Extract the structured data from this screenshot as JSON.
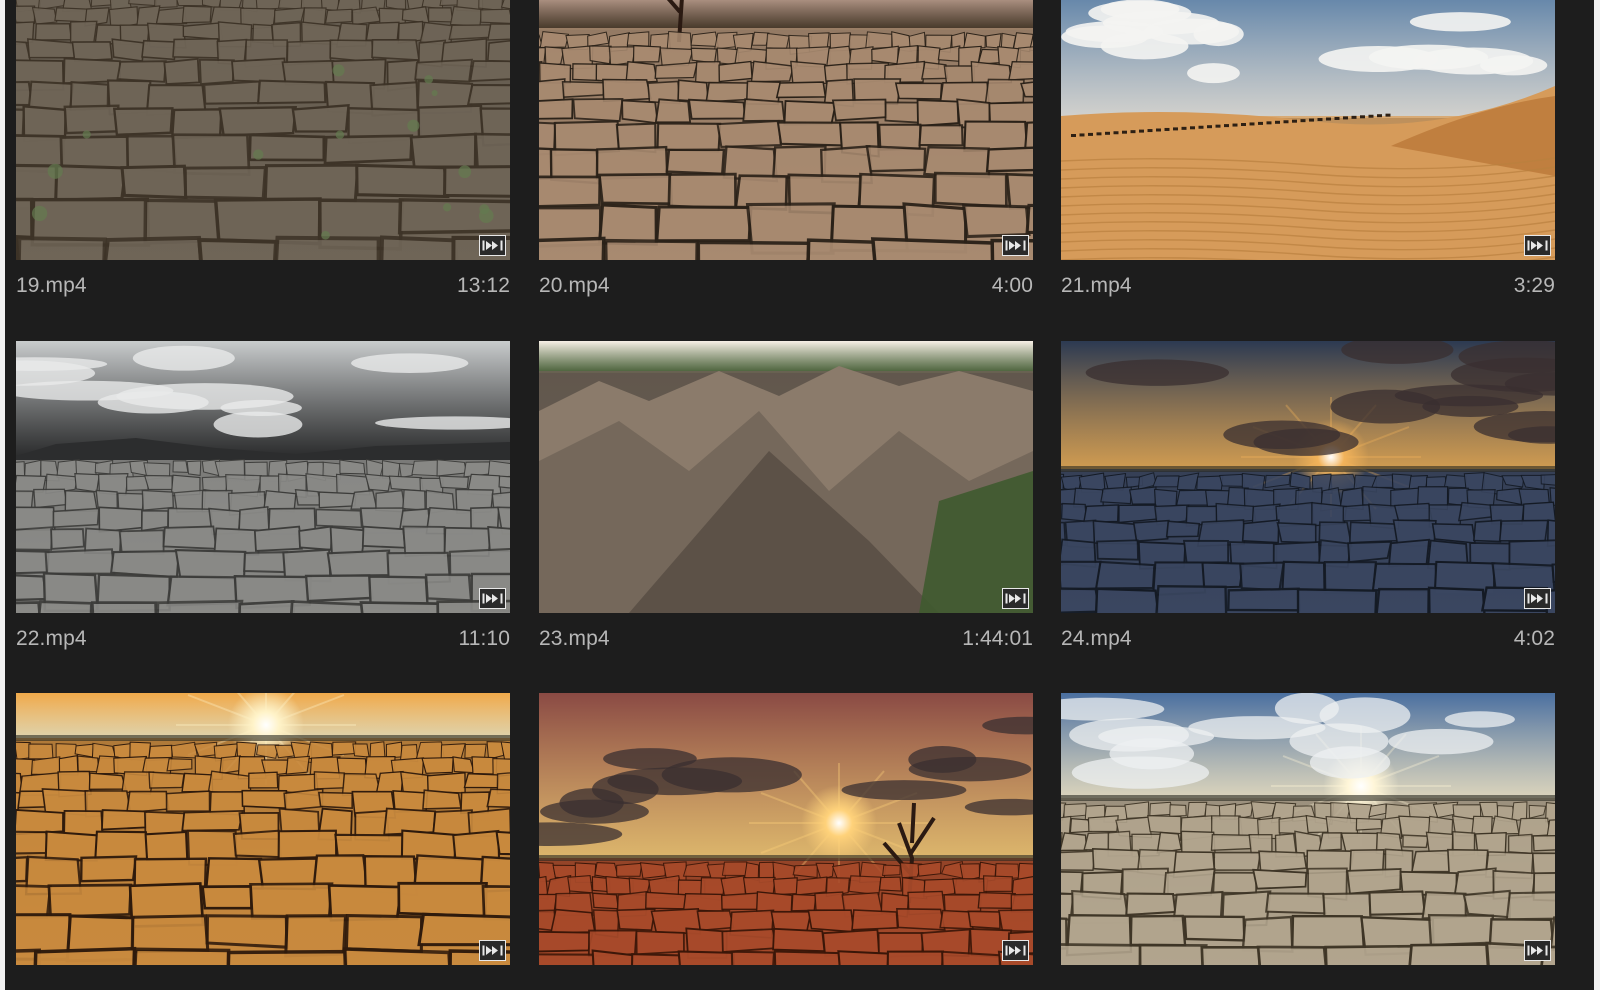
{
  "clips": [
    {
      "name": "19.mp4",
      "duration": "13:12",
      "icon": "video-clip-icon",
      "scene": "cracked-earth-grass",
      "colors": {
        "top": "#8b8d8f",
        "bottom": "#6f6557",
        "crack": "#3d3327",
        "accent": "#647a50"
      }
    },
    {
      "name": "20.mp4",
      "duration": "4:00",
      "icon": "video-clip-icon",
      "scene": "cracked-earth-tree",
      "colors": {
        "top": "#d8b7a8",
        "bottom": "#a88a70",
        "crack": "#2a2118",
        "accent": "#4a3a28"
      }
    },
    {
      "name": "21.mp4",
      "duration": "3:29",
      "icon": "video-clip-icon",
      "scene": "desert-dunes-camels",
      "colors": {
        "top": "#5a7fa6",
        "bottom": "#d9a466",
        "crack": "#8c6034",
        "accent": "#f2f1ec"
      }
    },
    {
      "name": "22.mp4",
      "duration": "11:10",
      "icon": "video-clip-icon",
      "scene": "grey-salt-flat",
      "colors": {
        "top": "#c9cccd",
        "bottom": "#8a8a87",
        "crack": "#3c3c3a",
        "accent": "#2c2d2e"
      }
    },
    {
      "name": "23.mp4",
      "duration": "1:44:01",
      "icon": "video-clip-icon",
      "scene": "aerial-mountains",
      "colors": {
        "top": "#f7f0e6",
        "bottom": "#6d6155",
        "crack": "#3a332d",
        "accent": "#4f6b3c"
      }
    },
    {
      "name": "24.mp4",
      "duration": "4:02",
      "icon": "video-clip-icon",
      "scene": "stormy-sunset-cracked",
      "colors": {
        "top": "#2c3a52",
        "bottom": "#3a4660",
        "crack": "#141a24",
        "accent": "#f2b35a"
      }
    },
    {
      "name": "",
      "duration": "",
      "icon": "video-clip-icon",
      "scene": "golden-sunrise-cracks",
      "colors": {
        "top": "#f0a94a",
        "bottom": "#c98a3e",
        "crack": "#2e1a0c",
        "accent": "#fff3c8"
      }
    },
    {
      "name": "",
      "duration": "",
      "icon": "video-clip-icon",
      "scene": "orange-sunset-dead-tree",
      "colors": {
        "top": "#8a4a44",
        "bottom": "#a84a2a",
        "crack": "#3a1608",
        "accent": "#ffd27a"
      }
    },
    {
      "name": "",
      "duration": "",
      "icon": "video-clip-icon",
      "scene": "blue-sky-sunburst-cracks",
      "colors": {
        "top": "#4a6fa0",
        "bottom": "#b2a58e",
        "crack": "#3e3526",
        "accent": "#fff6d8"
      }
    }
  ]
}
